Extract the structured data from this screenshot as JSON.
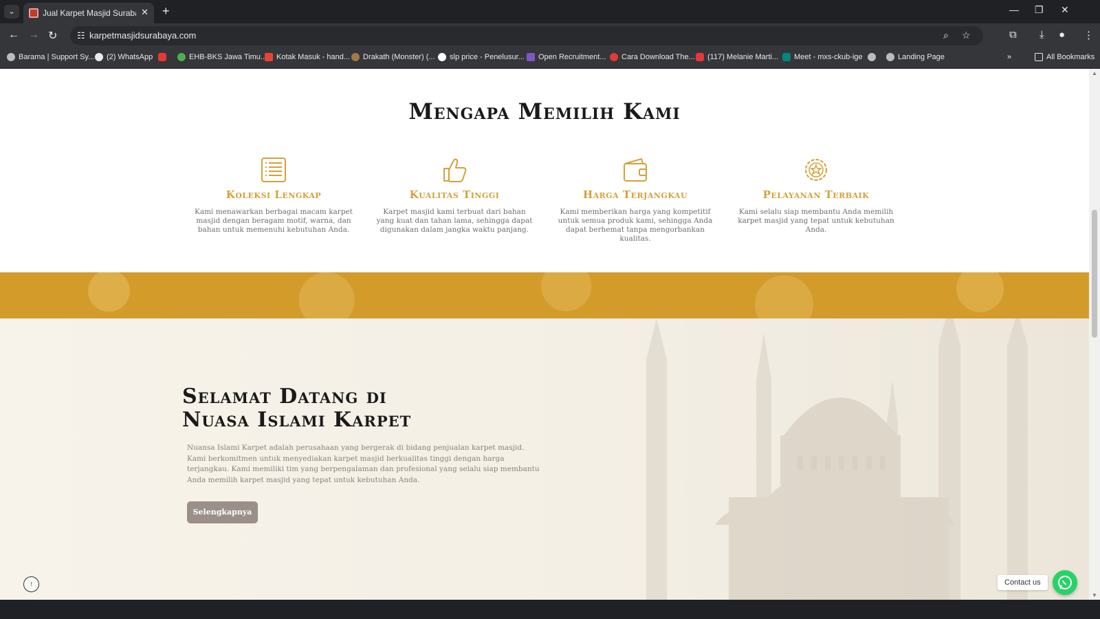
{
  "browser": {
    "tab_title": "Jual Karpet Masjid Surabaya - N",
    "url": "karpetmasjidsurabaya.com",
    "bookmarks": [
      {
        "label": "Barama | Support Sy...",
        "icon": "globe-icon"
      },
      {
        "label": "(2) WhatsApp",
        "icon": "whatsapp-icon"
      },
      {
        "label": "",
        "icon": "youtube-icon"
      },
      {
        "label": "EHB-BKS Jawa Timu...",
        "icon": "globe-icon"
      },
      {
        "label": "Kotak Masuk - hand...",
        "icon": "gmail-icon"
      },
      {
        "label": "Drakath (Monster) (...",
        "icon": "game-icon"
      },
      {
        "label": "slp price - Penelusur...",
        "icon": "google-icon"
      },
      {
        "label": "Open Recruitment...",
        "icon": "form-icon"
      },
      {
        "label": "Cara Download The...",
        "icon": "s-icon"
      },
      {
        "label": "(117) Melanie Marti...",
        "icon": "youtube-icon"
      },
      {
        "label": "Meet - mxs-ckub-ige",
        "icon": "meet-icon"
      },
      {
        "label": "",
        "icon": "globe-icon"
      },
      {
        "label": "Landing Page",
        "icon": "globe-icon"
      }
    ],
    "all_bookmarks": "All Bookmarks"
  },
  "page": {
    "why_title": "Mengapa Memilih Kami",
    "features": [
      {
        "icon": "list-icon",
        "title": "Koleksi Lengkap",
        "desc": "Kami menawarkan berbagai macam karpet masjid dengan beragam motif, warna, dan bahan untuk memenuhi kebutuhan Anda."
      },
      {
        "icon": "thumbs-up-icon",
        "title": "Kualitas Tinggi",
        "desc": "Karpet masjid kami terbuat dari bahan yang kuat dan tahan lama, sehingga dapat digunakan dalam jangka waktu panjang."
      },
      {
        "icon": "wallet-icon",
        "title": "Harga Terjangkau",
        "desc": "Kami memberikan harga yang kompetitif untuk semua produk kami, sehingga Anda dapat berhemat tanpa mengorbankan kualitas."
      },
      {
        "icon": "award-icon",
        "title": "Pelayanan Terbaik",
        "desc": "Kami selalu siap membantu Anda memilih karpet masjid yang tepat untuk kebutuhan Anda."
      }
    ],
    "welcome": {
      "title_line1": "Selamat Datang di",
      "title_line2": "Nuasa Islami Karpet",
      "text": "Nuansa Islami Karpet adalah perusahaan yang bergerak di bidang penjualan karpet masjid. Kami berkomitmen untuk menyediakan karpet masjid berkualitas tinggi dengan harga terjangkau. Kami memiliki tim yang berpengalaman dan profesional yang selalu siap membantu Anda memilih karpet masjid yang tepat untuk kebutuhan Anda.",
      "button": "Selengkapnya"
    },
    "contact_label": "Contact us"
  },
  "colors": {
    "accent_gold": "#d4a137",
    "band_gold": "#d39b2a",
    "button_gray": "#9a9089",
    "whatsapp_green": "#25d366"
  }
}
